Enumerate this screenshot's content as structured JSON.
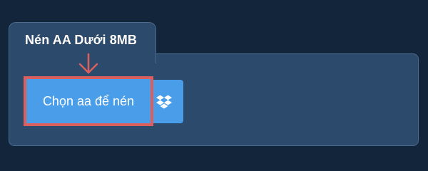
{
  "tab": {
    "title": "Nén AA Dưới 8MB"
  },
  "upload": {
    "button_label": "Chọn aa để nén",
    "dropbox_icon": "dropbox-icon"
  },
  "annotation": {
    "arrow_icon": "arrow-down-icon"
  },
  "colors": {
    "background": "#13253a",
    "panel": "#2c4a6b",
    "panel_border": "#4a6a8e",
    "button": "#4a9de8",
    "highlight": "#d9605e",
    "text": "#ffffff"
  }
}
